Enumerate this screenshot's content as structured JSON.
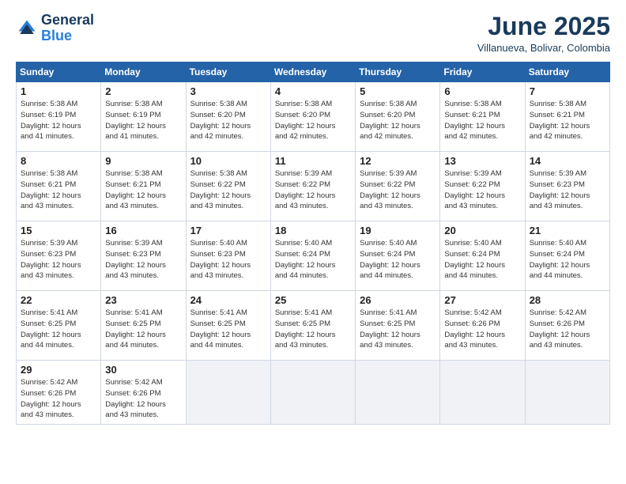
{
  "header": {
    "logo_line1": "General",
    "logo_line2": "Blue",
    "month": "June 2025",
    "location": "Villanueva, Bolivar, Colombia"
  },
  "weekdays": [
    "Sunday",
    "Monday",
    "Tuesday",
    "Wednesday",
    "Thursday",
    "Friday",
    "Saturday"
  ],
  "weeks": [
    [
      {
        "day": 1,
        "info": "Sunrise: 5:38 AM\nSunset: 6:19 PM\nDaylight: 12 hours\nand 41 minutes."
      },
      {
        "day": 2,
        "info": "Sunrise: 5:38 AM\nSunset: 6:19 PM\nDaylight: 12 hours\nand 41 minutes."
      },
      {
        "day": 3,
        "info": "Sunrise: 5:38 AM\nSunset: 6:20 PM\nDaylight: 12 hours\nand 42 minutes."
      },
      {
        "day": 4,
        "info": "Sunrise: 5:38 AM\nSunset: 6:20 PM\nDaylight: 12 hours\nand 42 minutes."
      },
      {
        "day": 5,
        "info": "Sunrise: 5:38 AM\nSunset: 6:20 PM\nDaylight: 12 hours\nand 42 minutes."
      },
      {
        "day": 6,
        "info": "Sunrise: 5:38 AM\nSunset: 6:21 PM\nDaylight: 12 hours\nand 42 minutes."
      },
      {
        "day": 7,
        "info": "Sunrise: 5:38 AM\nSunset: 6:21 PM\nDaylight: 12 hours\nand 42 minutes."
      }
    ],
    [
      {
        "day": 8,
        "info": "Sunrise: 5:38 AM\nSunset: 6:21 PM\nDaylight: 12 hours\nand 43 minutes."
      },
      {
        "day": 9,
        "info": "Sunrise: 5:38 AM\nSunset: 6:21 PM\nDaylight: 12 hours\nand 43 minutes."
      },
      {
        "day": 10,
        "info": "Sunrise: 5:38 AM\nSunset: 6:22 PM\nDaylight: 12 hours\nand 43 minutes."
      },
      {
        "day": 11,
        "info": "Sunrise: 5:39 AM\nSunset: 6:22 PM\nDaylight: 12 hours\nand 43 minutes."
      },
      {
        "day": 12,
        "info": "Sunrise: 5:39 AM\nSunset: 6:22 PM\nDaylight: 12 hours\nand 43 minutes."
      },
      {
        "day": 13,
        "info": "Sunrise: 5:39 AM\nSunset: 6:22 PM\nDaylight: 12 hours\nand 43 minutes."
      },
      {
        "day": 14,
        "info": "Sunrise: 5:39 AM\nSunset: 6:23 PM\nDaylight: 12 hours\nand 43 minutes."
      }
    ],
    [
      {
        "day": 15,
        "info": "Sunrise: 5:39 AM\nSunset: 6:23 PM\nDaylight: 12 hours\nand 43 minutes."
      },
      {
        "day": 16,
        "info": "Sunrise: 5:39 AM\nSunset: 6:23 PM\nDaylight: 12 hours\nand 43 minutes."
      },
      {
        "day": 17,
        "info": "Sunrise: 5:40 AM\nSunset: 6:23 PM\nDaylight: 12 hours\nand 43 minutes."
      },
      {
        "day": 18,
        "info": "Sunrise: 5:40 AM\nSunset: 6:24 PM\nDaylight: 12 hours\nand 44 minutes."
      },
      {
        "day": 19,
        "info": "Sunrise: 5:40 AM\nSunset: 6:24 PM\nDaylight: 12 hours\nand 44 minutes."
      },
      {
        "day": 20,
        "info": "Sunrise: 5:40 AM\nSunset: 6:24 PM\nDaylight: 12 hours\nand 44 minutes."
      },
      {
        "day": 21,
        "info": "Sunrise: 5:40 AM\nSunset: 6:24 PM\nDaylight: 12 hours\nand 44 minutes."
      }
    ],
    [
      {
        "day": 22,
        "info": "Sunrise: 5:41 AM\nSunset: 6:25 PM\nDaylight: 12 hours\nand 44 minutes."
      },
      {
        "day": 23,
        "info": "Sunrise: 5:41 AM\nSunset: 6:25 PM\nDaylight: 12 hours\nand 44 minutes."
      },
      {
        "day": 24,
        "info": "Sunrise: 5:41 AM\nSunset: 6:25 PM\nDaylight: 12 hours\nand 44 minutes."
      },
      {
        "day": 25,
        "info": "Sunrise: 5:41 AM\nSunset: 6:25 PM\nDaylight: 12 hours\nand 43 minutes."
      },
      {
        "day": 26,
        "info": "Sunrise: 5:41 AM\nSunset: 6:25 PM\nDaylight: 12 hours\nand 43 minutes."
      },
      {
        "day": 27,
        "info": "Sunrise: 5:42 AM\nSunset: 6:26 PM\nDaylight: 12 hours\nand 43 minutes."
      },
      {
        "day": 28,
        "info": "Sunrise: 5:42 AM\nSunset: 6:26 PM\nDaylight: 12 hours\nand 43 minutes."
      }
    ],
    [
      {
        "day": 29,
        "info": "Sunrise: 5:42 AM\nSunset: 6:26 PM\nDaylight: 12 hours\nand 43 minutes."
      },
      {
        "day": 30,
        "info": "Sunrise: 5:42 AM\nSunset: 6:26 PM\nDaylight: 12 hours\nand 43 minutes."
      },
      null,
      null,
      null,
      null,
      null
    ]
  ]
}
